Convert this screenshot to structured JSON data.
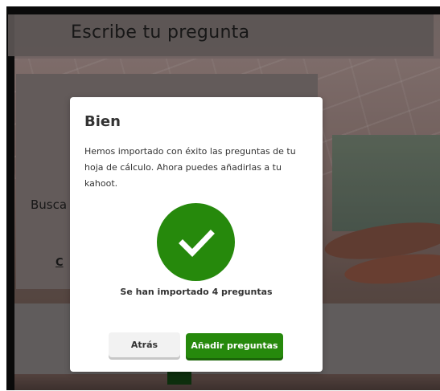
{
  "background": {
    "header_title": "Escribe tu pregunta",
    "partial_text_busca": "Busca",
    "partial_text_c": "C"
  },
  "modal": {
    "title": "Bien",
    "message": "Hemos importado con éxito las preguntas de tu hoja de cálculo. Ahora puedes añadirlas a tu kahoot.",
    "status_icon": "checkmark-icon",
    "status_text": "Se han importado 4 preguntas",
    "back_label": "Atrás",
    "add_label": "Añadir preguntas"
  },
  "colors": {
    "success_green": "#26890c",
    "button_back_bg": "#f2f2f2",
    "text_dark": "#333333"
  }
}
